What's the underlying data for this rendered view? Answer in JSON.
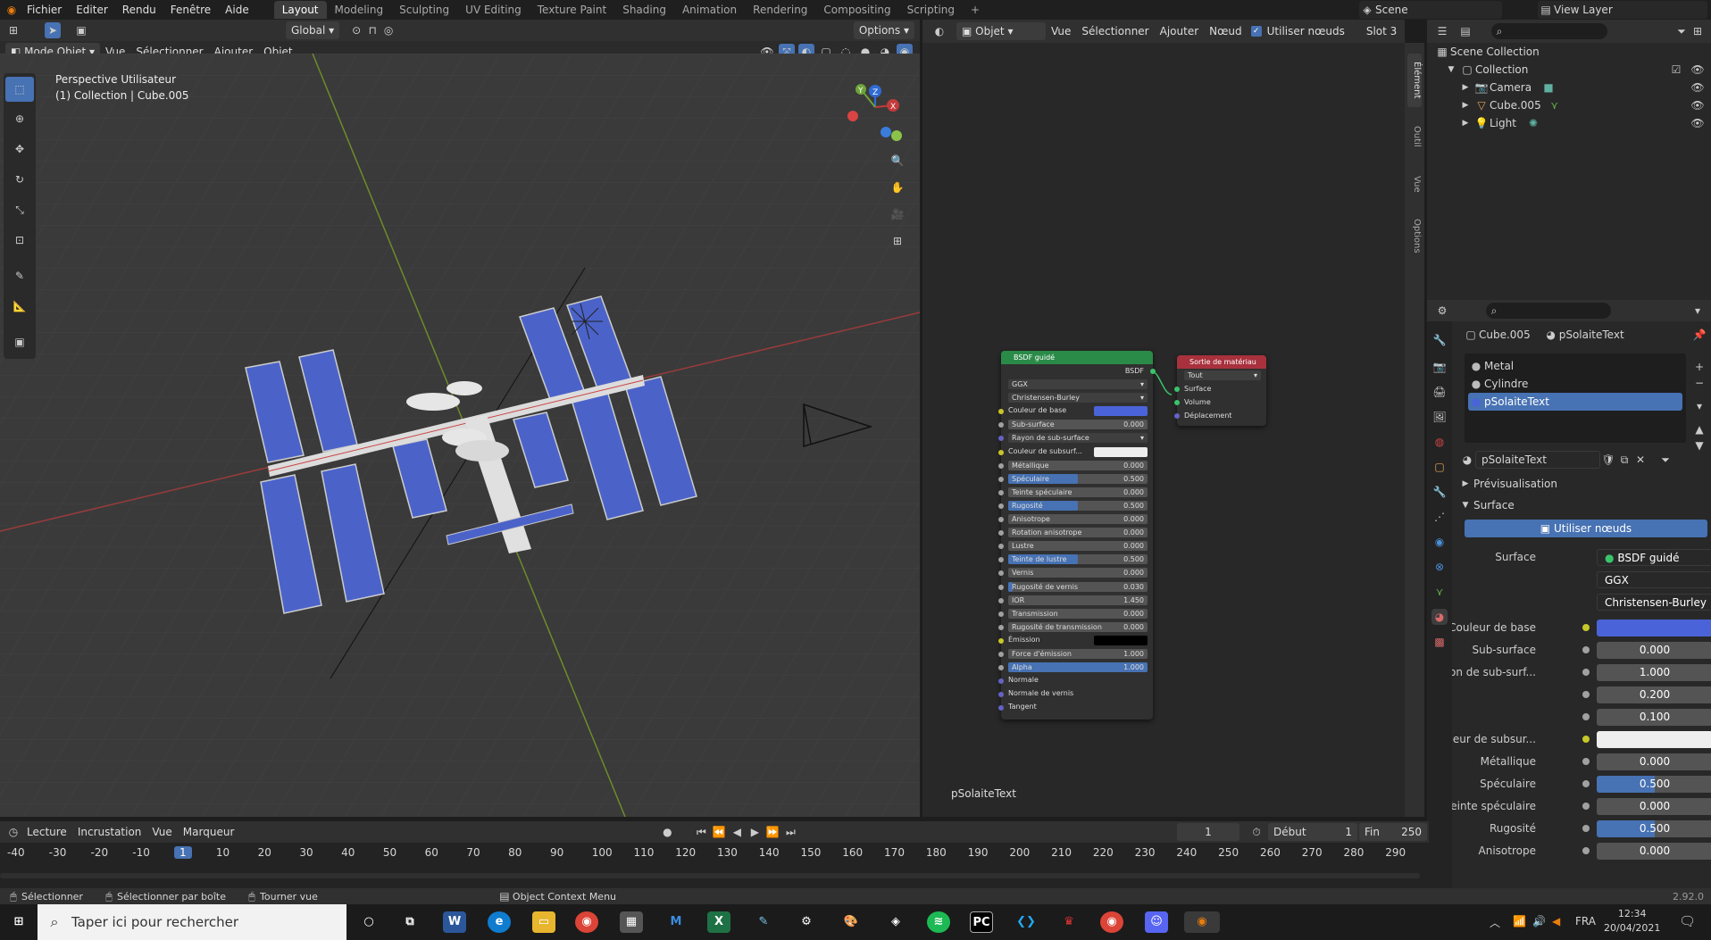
{
  "topbar": {
    "menus": [
      "Fichier",
      "Editer",
      "Rendu",
      "Fenêtre",
      "Aide"
    ],
    "workspaces": [
      "Layout",
      "Modeling",
      "Sculpting",
      "UV Editing",
      "Texture Paint",
      "Shading",
      "Animation",
      "Rendering",
      "Compositing",
      "Scripting"
    ],
    "active_workspace": "Layout",
    "add_tab": "+",
    "scene": "Scene",
    "view_layer": "View Layer"
  },
  "viewport": {
    "transform": "Global",
    "options": "Options",
    "mode": "Mode Objet",
    "menu": [
      "Vue",
      "Sélectionner",
      "Ajouter",
      "Objet"
    ],
    "overlay_title": "Perspective Utilisateur",
    "overlay_sub": "(1) Collection | Cube.005",
    "gizmo": {
      "x": "X",
      "y": "Y",
      "z": "Z"
    }
  },
  "node_editor": {
    "editor_type": "Objet",
    "menu": [
      "Vue",
      "Sélectionner",
      "Ajouter",
      "Nœud"
    ],
    "use_nodes": "Utiliser nœuds",
    "slot": "Slot 3",
    "material_label": "pSolaiteText",
    "side_tabs": [
      "Élément",
      "Outil",
      "Vue",
      "Options"
    ],
    "bsdf": {
      "title": "BSDF guidé",
      "output": "BSDF",
      "dist": "GGX",
      "sss": "Christensen-Burley",
      "rows": [
        {
          "label": "Couleur de base",
          "type": "color",
          "color": "#4b63d9",
          "sock": "#c7c729"
        },
        {
          "label": "Sub-surface",
          "value": "0.000",
          "sock": "#a1a1a1"
        },
        {
          "label": "Rayon de sub-surface",
          "type": "dropdown",
          "sock": "#6363c7"
        },
        {
          "label": "Couleur de subsurf...",
          "type": "color",
          "color": "#eeeeee",
          "sock": "#c7c729"
        },
        {
          "label": "Métallique",
          "value": "0.000",
          "sock": "#a1a1a1"
        },
        {
          "label": "Spéculaire",
          "value": "0.500",
          "fill": 0.5,
          "sock": "#a1a1a1"
        },
        {
          "label": "Teinte spéculaire",
          "value": "0.000",
          "sock": "#a1a1a1"
        },
        {
          "label": "Rugosité",
          "value": "0.500",
          "fill": 0.5,
          "sock": "#a1a1a1"
        },
        {
          "label": "Anisotrope",
          "value": "0.000",
          "sock": "#a1a1a1"
        },
        {
          "label": "Rotation anisotrope",
          "value": "0.000",
          "sock": "#a1a1a1"
        },
        {
          "label": "Lustre",
          "value": "0.000",
          "sock": "#a1a1a1"
        },
        {
          "label": "Teinte de lustre",
          "value": "0.500",
          "fill": 0.5,
          "sock": "#a1a1a1"
        },
        {
          "label": "Vernis",
          "value": "0.000",
          "sock": "#a1a1a1"
        },
        {
          "label": "Rugosité de vernis",
          "value": "0.030",
          "fill": 0.03,
          "sock": "#a1a1a1"
        },
        {
          "label": "IOR",
          "value": "1.450",
          "sock": "#a1a1a1"
        },
        {
          "label": "Transmission",
          "value": "0.000",
          "sock": "#a1a1a1"
        },
        {
          "label": "Rugosité de transmission",
          "value": "0.000",
          "sock": "#a1a1a1"
        },
        {
          "label": "Émission",
          "type": "color",
          "color": "#000000",
          "sock": "#c7c729"
        },
        {
          "label": "Force d'émission",
          "value": "1.000",
          "sock": "#a1a1a1"
        },
        {
          "label": "Alpha",
          "value": "1.000",
          "fill": 1.0,
          "sock": "#a1a1a1"
        },
        {
          "label": "Normale",
          "type": "plain",
          "sock": "#6363c7"
        },
        {
          "label": "Normale de vernis",
          "type": "plain",
          "sock": "#6363c7"
        },
        {
          "label": "Tangent",
          "type": "plain",
          "sock": "#6363c7"
        }
      ]
    },
    "output": {
      "title": "Sortie de matériau",
      "target": "Tout",
      "inputs": [
        "Surface",
        "Volume",
        "Déplacement"
      ]
    }
  },
  "outliner": {
    "root": "Scene Collection",
    "collection": "Collection",
    "items": [
      "Camera",
      "Cube.005",
      "Light"
    ]
  },
  "properties": {
    "object": "Cube.005",
    "material": "pSolaiteText",
    "slots": [
      "Metal",
      "Cylindre",
      "pSolaiteText"
    ],
    "datablock": "pSolaiteText",
    "preview": "Prévisualisation",
    "surface_panel": "Surface",
    "use_nodes": "Utiliser nœuds",
    "surface_label": "Surface",
    "surface_value": "BSDF guidé",
    "dist": "GGX",
    "sss": "Christensen-Burley",
    "rows": [
      {
        "label": "Couleur de base",
        "type": "color",
        "color": "#4b63d9"
      },
      {
        "label": "Sub-surface",
        "value": "0.000"
      },
      {
        "label": "Rayon de sub-surf...",
        "value": "1.000"
      },
      {
        "label": "",
        "value": "0.200"
      },
      {
        "label": "",
        "value": "0.100"
      },
      {
        "label": "Couleur de subsur...",
        "type": "color",
        "color": "#eeeeee"
      },
      {
        "label": "Métallique",
        "value": "0.000"
      },
      {
        "label": "Spéculaire",
        "value": "0.500",
        "fill": 0.5
      },
      {
        "label": "Teinte spéculaire",
        "value": "0.000"
      },
      {
        "label": "Rugosité",
        "value": "0.500",
        "fill": 0.5
      },
      {
        "label": "Anisotrope",
        "value": "0.000"
      }
    ]
  },
  "timeline": {
    "menus": [
      "Lecture",
      "Incrustation",
      "Vue",
      "Marqueur"
    ],
    "frame": "1",
    "start_label": "Début",
    "start": "1",
    "end_label": "Fin",
    "end": "250",
    "ticks": [
      "-40",
      "-30",
      "-20",
      "-10",
      "1",
      "10",
      "20",
      "30",
      "40",
      "50",
      "60",
      "70",
      "80",
      "90",
      "100",
      "110",
      "120",
      "130",
      "140",
      "150",
      "160",
      "170",
      "180",
      "190",
      "200",
      "210",
      "220",
      "230",
      "240",
      "250",
      "260",
      "270",
      "280",
      "290"
    ],
    "current_tick": "1"
  },
  "status": {
    "select": "Sélectionner",
    "box": "Sélectionner par boîte",
    "rotate": "Tourner vue",
    "context": "Object Context Menu",
    "version": "2.92.0"
  },
  "taskbar": {
    "search": "Taper ici pour rechercher",
    "lang": "FRA",
    "time": "12:34",
    "date": "20/04/2021"
  }
}
